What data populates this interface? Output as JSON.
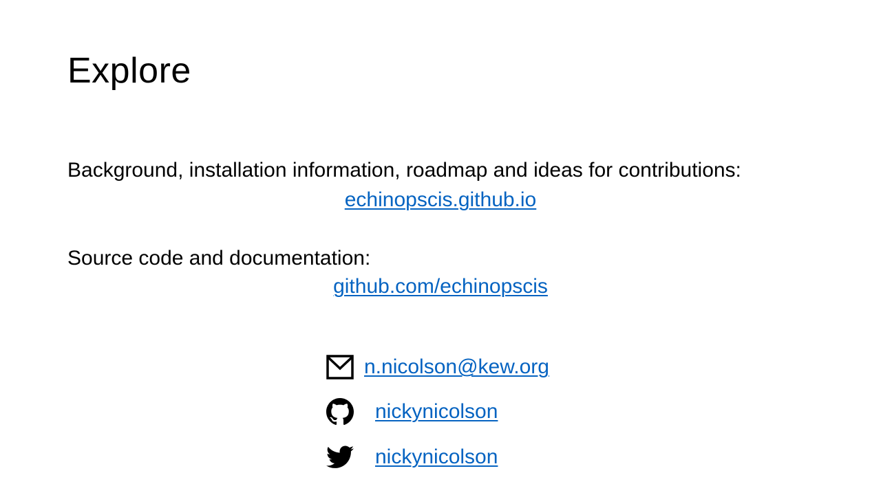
{
  "slide": {
    "title": "Explore"
  },
  "sections": [
    {
      "heading": "Background, installation information, roadmap and ideas for contributions:",
      "link": "echinopscis.github.io"
    },
    {
      "heading": "Source code and documentation:",
      "link": "github.com/echinopscis"
    }
  ],
  "contacts": {
    "email": {
      "icon": "envelope-icon",
      "label": "n.nicolson@kew.org"
    },
    "github": {
      "icon": "github-icon",
      "label": "nickynicolson"
    },
    "twitter": {
      "icon": "twitter-icon",
      "label": "nickynicolson"
    }
  },
  "colors": {
    "link": "#0563c1",
    "text": "#000000",
    "background": "#ffffff"
  }
}
